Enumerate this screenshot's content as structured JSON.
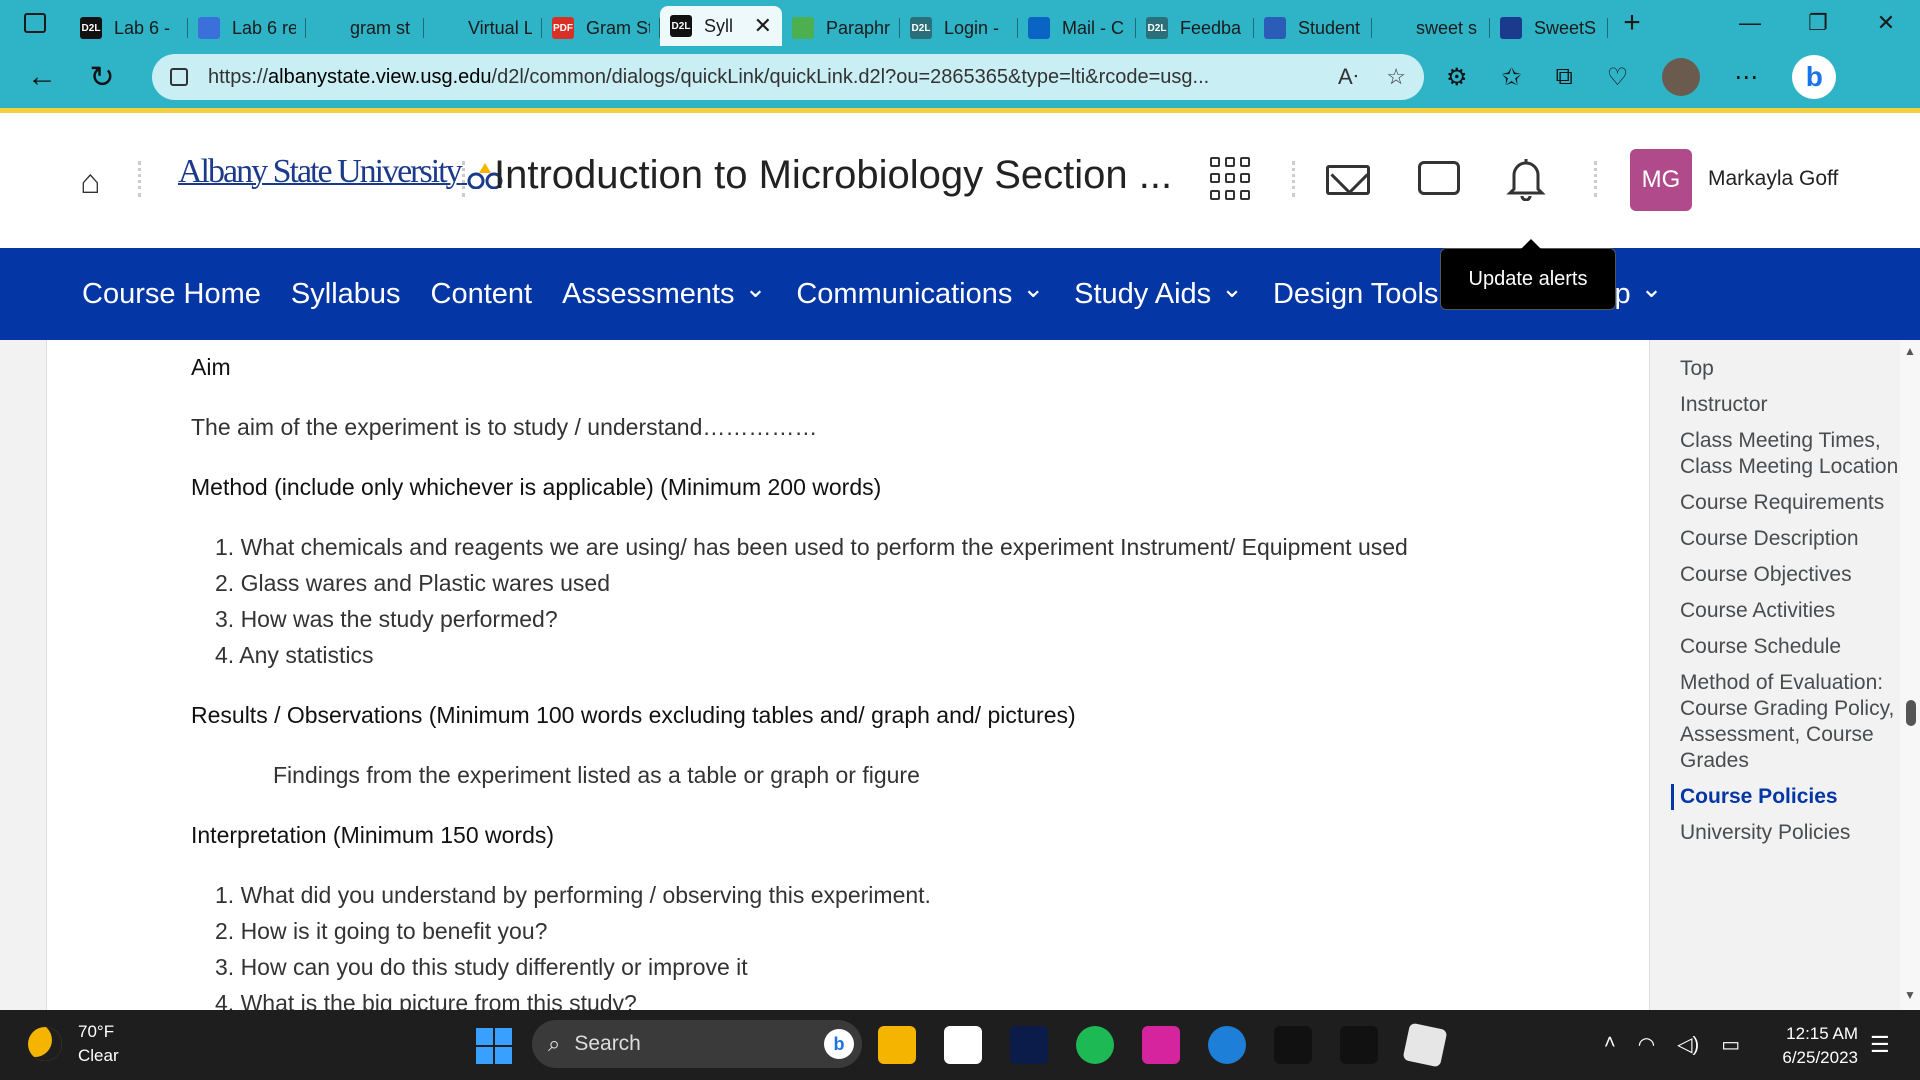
{
  "browser": {
    "tabs": [
      {
        "favicon": "D2L",
        "title": "Lab 6 -",
        "color": "#111111"
      },
      {
        "favicon": "doc-icon",
        "title": "Lab 6 re",
        "color": "#3b6fd9"
      },
      {
        "favicon": "search-icon",
        "title": "gram st",
        "color": "#2fb3c6"
      },
      {
        "favicon": "page-icon",
        "title": "Virtual L",
        "color": "#2fb3c6"
      },
      {
        "favicon": "PDF",
        "title": "Gram St",
        "color": "#d93025"
      },
      {
        "favicon": "D2L",
        "title": "Syll",
        "color": "#111111",
        "active": true
      },
      {
        "favicon": "paraphrase-icon",
        "title": "Paraphr",
        "color": "#4caf50"
      },
      {
        "favicon": "D2L",
        "title": "Login -",
        "color": "#2a6f7a"
      },
      {
        "favicon": "outlook-icon",
        "title": "Mail - C",
        "color": "#0a64c4"
      },
      {
        "favicon": "D2L",
        "title": "Feedba",
        "color": "#2a6f7a"
      },
      {
        "favicon": "asu-icon",
        "title": "Student",
        "color": "#2b5cb8"
      },
      {
        "favicon": "search-icon",
        "title": "sweet s",
        "color": "#2fb3c6"
      },
      {
        "favicon": "circle-icon",
        "title": "SweetS",
        "color": "#1c3a8c"
      }
    ],
    "url_host": "albanystate.view.usg.edu",
    "url_prefix": "https://",
    "url_path": "/d2l/common/dialogs/quickLink/quickLink.d2l?ou=2865365&type=lti&rcode=usg..."
  },
  "header": {
    "logo_text": "Albany State University",
    "course_title": "Introduction to Microbiology Section ...",
    "user_initials": "MG",
    "user_name": "Markayla Goff",
    "avatar_color": "#b04a8a"
  },
  "navbar": {
    "items": [
      {
        "label": "Course Home",
        "dropdown": false
      },
      {
        "label": "Syllabus",
        "dropdown": false
      },
      {
        "label": "Content",
        "dropdown": false
      },
      {
        "label": "Assessments",
        "dropdown": true
      },
      {
        "label": "Communications",
        "dropdown": true
      },
      {
        "label": "Study Aids",
        "dropdown": true
      },
      {
        "label": "Design Tools",
        "dropdown": true
      },
      {
        "label": "lp",
        "dropdown": true
      }
    ],
    "tooltip": "Update alerts",
    "bg_color": "#0436a6"
  },
  "content": {
    "aim_heading": "Aim",
    "aim_text": "The aim of the experiment is to study / understand……………",
    "method_heading": "Method (include only whichever is applicable) (Minimum 200 words)",
    "method_items": [
      "1. What chemicals and reagents we are using/ has been used to perform the experiment Instrument/ Equipment used",
      "2. Glass wares and Plastic wares used",
      "3. How was the study performed?",
      "4. Any statistics"
    ],
    "results_heading": "Results / Observations (Minimum 100 words excluding tables and/ graph and/ pictures)",
    "results_text": "Findings from the experiment listed as a table or graph or figure",
    "interpretation_heading": "Interpretation (Minimum 150 words)",
    "interpretation_items": [
      "1. What did you understand by performing / observing this experiment.",
      "2. How is it going to benefit you?",
      "3. How can you do this study differently or improve it",
      "4. What is the big picture from this study?"
    ]
  },
  "toc": {
    "items": [
      {
        "label": "Top"
      },
      {
        "label": "Instructor"
      },
      {
        "label": "Class Meeting Times, Class Meeting Location"
      },
      {
        "label": "Course Requirements"
      },
      {
        "label": "Course Description"
      },
      {
        "label": "Course Objectives"
      },
      {
        "label": "Course Activities"
      },
      {
        "label": "Course Schedule"
      },
      {
        "label": "Method of Evaluation: Course Grading Policy, Assessment, Course Grades"
      },
      {
        "label": "Course Policies",
        "active": true
      },
      {
        "label": "University Policies"
      }
    ]
  },
  "taskbar": {
    "weather_temp": "70°F",
    "weather_desc": "Clear",
    "search_placeholder": "Search",
    "time": "12:15 AM",
    "date": "6/25/2023",
    "apps": [
      "file-explorer-icon",
      "store-icon",
      "disney-plus-icon",
      "spotify-icon",
      "instagram-icon",
      "edge-icon",
      "netflix-icon",
      "hulu-icon",
      "roblox-icon"
    ]
  }
}
